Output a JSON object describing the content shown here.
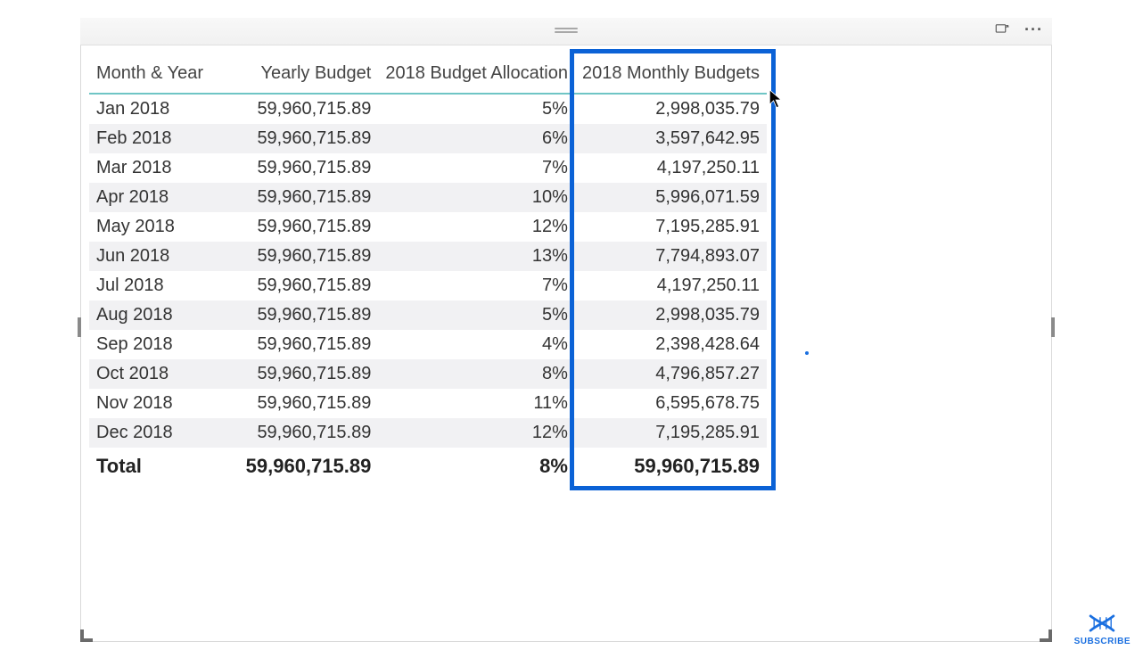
{
  "table": {
    "headers": {
      "month_year": "Month & Year",
      "yearly_budget": "Yearly Budget",
      "allocation": "2018 Budget Allocation",
      "monthly_budgets": "2018 Monthly Budgets"
    },
    "rows": [
      {
        "month": "Jan 2018",
        "yearly": "59,960,715.89",
        "alloc": "5%",
        "monthly": "2,998,035.79"
      },
      {
        "month": "Feb 2018",
        "yearly": "59,960,715.89",
        "alloc": "6%",
        "monthly": "3,597,642.95"
      },
      {
        "month": "Mar 2018",
        "yearly": "59,960,715.89",
        "alloc": "7%",
        "monthly": "4,197,250.11"
      },
      {
        "month": "Apr 2018",
        "yearly": "59,960,715.89",
        "alloc": "10%",
        "monthly": "5,996,071.59"
      },
      {
        "month": "May 2018",
        "yearly": "59,960,715.89",
        "alloc": "12%",
        "monthly": "7,195,285.91"
      },
      {
        "month": "Jun 2018",
        "yearly": "59,960,715.89",
        "alloc": "13%",
        "monthly": "7,794,893.07"
      },
      {
        "month": "Jul 2018",
        "yearly": "59,960,715.89",
        "alloc": "7%",
        "monthly": "4,197,250.11"
      },
      {
        "month": "Aug 2018",
        "yearly": "59,960,715.89",
        "alloc": "5%",
        "monthly": "2,998,035.79"
      },
      {
        "month": "Sep 2018",
        "yearly": "59,960,715.89",
        "alloc": "4%",
        "monthly": "2,398,428.64"
      },
      {
        "month": "Oct 2018",
        "yearly": "59,960,715.89",
        "alloc": "8%",
        "monthly": "4,796,857.27"
      },
      {
        "month": "Nov 2018",
        "yearly": "59,960,715.89",
        "alloc": "11%",
        "monthly": "6,595,678.75"
      },
      {
        "month": "Dec 2018",
        "yearly": "59,960,715.89",
        "alloc": "12%",
        "monthly": "7,195,285.91"
      }
    ],
    "total": {
      "label": "Total",
      "yearly": "59,960,715.89",
      "alloc": "8%",
      "monthly": "59,960,715.89"
    }
  },
  "badge": {
    "subscribe": "SUBSCRIBE"
  }
}
